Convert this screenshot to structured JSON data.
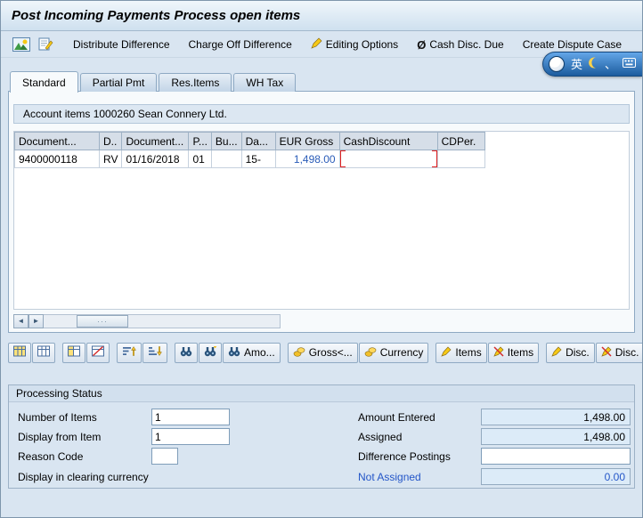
{
  "colors": {
    "accent_value_blue": "#2a5cb8",
    "highlight_cell_yellow": "#fdf2a8",
    "selection_bracket_red": "#e02020",
    "link_blue": "#2456c8",
    "window_background": "#d9e5f1"
  },
  "window": {
    "title": "Post Incoming Payments Process open items"
  },
  "toolbar": {
    "distribute_difference": "Distribute Difference",
    "charge_off_difference": "Charge Off Difference",
    "editing_options": "Editing Options",
    "cash_disc_due_prefix": "Ø",
    "cash_disc_due": "Cash Disc. Due",
    "create_dispute_case": "Create Dispute Case"
  },
  "ime_toolbar": {
    "language_mode": "英",
    "punctuation_mode": "、"
  },
  "tabs": {
    "active": "Standard",
    "items": [
      {
        "label": "Standard"
      },
      {
        "label": "Partial Pmt"
      },
      {
        "label": "Res.Items"
      },
      {
        "label": "WH Tax"
      }
    ]
  },
  "open_items": {
    "account_header": "Account items 1000260 Sean Connery Ltd.",
    "columns": [
      "Document...",
      "D..",
      "Document...",
      "P...",
      "Bu...",
      "Da...",
      "EUR Gross",
      "CashDiscount",
      "CDPer."
    ],
    "row": {
      "document_number": "9400000118",
      "document_type": "RV",
      "document_date": "01/16/2018",
      "posting_key": "01",
      "business_area": "",
      "days": "15-",
      "eur_gross": "1,498.00",
      "cash_discount": "",
      "cd_percent": ""
    }
  },
  "item_actions": {
    "amount": "Amo...",
    "gross_net": "Gross<...",
    "currency": "Currency",
    "items_activate": "Items",
    "items_deactivate": "Items",
    "discount_activate": "Disc.",
    "discount_deactivate": "Disc."
  },
  "processing_status": {
    "title": "Processing Status",
    "number_of_items": {
      "label": "Number of Items",
      "value": "1"
    },
    "display_from_item": {
      "label": "Display from Item",
      "value": "1"
    },
    "reason_code": {
      "label": "Reason Code",
      "value": ""
    },
    "display_in_clearing_currency": {
      "label": "Display in clearing currency"
    },
    "amount_entered": {
      "label": "Amount Entered",
      "value": "1,498.00"
    },
    "assigned": {
      "label": "Assigned",
      "value": "1,498.00"
    },
    "difference_postings": {
      "label": "Difference Postings",
      "value": ""
    },
    "not_assigned": {
      "label": "Not Assigned",
      "value": "0.00"
    }
  }
}
